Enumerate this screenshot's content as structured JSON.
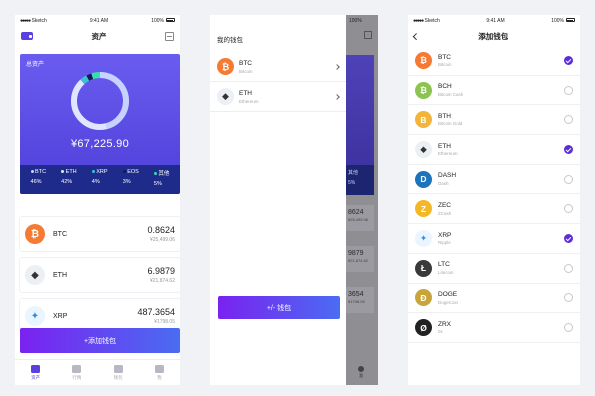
{
  "status": {
    "carrier": "Sketch",
    "time": "9:41 AM",
    "battery": "100%"
  },
  "screen1": {
    "title": "资产",
    "asset_label": "总资产",
    "total": "¥67,225.90",
    "legend": [
      {
        "name": "BTC",
        "pct": "46%",
        "color": "#c7d2ff"
      },
      {
        "name": "ETH",
        "pct": "42%",
        "color": "#e0e6ff"
      },
      {
        "name": "XRP",
        "pct": "4%",
        "color": "#3ac1d8"
      },
      {
        "name": "EOS",
        "pct": "3%",
        "color": "#141a55"
      },
      {
        "name": "其他",
        "pct": "5%",
        "color": "#2ee3a8"
      }
    ],
    "coins": [
      {
        "sym": "BTC",
        "amount": "0.8624",
        "cny": "¥25,499.06",
        "color": "#f57a33",
        "glyph": "₿"
      },
      {
        "sym": "ETH",
        "amount": "6.9879",
        "cny": "¥21,874.62",
        "color": "#eceff4",
        "glyph": "◆"
      },
      {
        "sym": "XRP",
        "amount": "487.3654",
        "cny": "¥1798.05",
        "color": "#eaf5ff",
        "glyph": "✦"
      }
    ],
    "add_button": "+添加钱包",
    "tabs": [
      {
        "label": "资产",
        "active": true,
        "icon": "wallet-icon"
      },
      {
        "label": "行情",
        "active": false,
        "icon": "chart-icon"
      },
      {
        "label": "钱包",
        "active": false,
        "icon": "briefcase-icon"
      },
      {
        "label": "我",
        "active": false,
        "icon": "user-icon"
      }
    ]
  },
  "screen2": {
    "drawer_title": "我的钱包",
    "wallets": [
      {
        "sym": "BTC",
        "name": "Bitcoin",
        "color": "#f57a33",
        "glyph": "₿"
      },
      {
        "sym": "ETH",
        "name": "Ethereum",
        "color": "#eceff4",
        "glyph": "◆"
      }
    ],
    "drawer_button": "+/- 钱包",
    "under": {
      "other_label": "其他",
      "other_pct": "5%",
      "values": [
        "8624",
        "9879",
        "3654"
      ],
      "subs": [
        "¥25,499.06",
        "¥21,874.62",
        "¥1798.05"
      ],
      "tab_label": "我"
    }
  },
  "screen3": {
    "title": "添加钱包",
    "coins": [
      {
        "sym": "BTC",
        "name": "Bitcoin",
        "color": "#f57a33",
        "glyph": "₿",
        "checked": true
      },
      {
        "sym": "BCH",
        "name": "Bitcoin Cash",
        "color": "#8dc351",
        "glyph": "₿",
        "checked": false
      },
      {
        "sym": "BTH",
        "name": "Bitcoin Gold",
        "color": "#f3b43a",
        "glyph": "B",
        "checked": false
      },
      {
        "sym": "ETH",
        "name": "Ethereum",
        "color": "#eceff4",
        "glyph": "◆",
        "checked": true
      },
      {
        "sym": "DASH",
        "name": "Dash",
        "color": "#1c75bc",
        "glyph": "D",
        "checked": false
      },
      {
        "sym": "ZEC",
        "name": "ZCash",
        "color": "#f4b728",
        "glyph": "Z",
        "checked": false
      },
      {
        "sym": "XRP",
        "name": "Ripple",
        "color": "#eaf5ff",
        "glyph": "✦",
        "checked": true
      },
      {
        "sym": "LTC",
        "name": "Litecoin",
        "color": "#3a3a3a",
        "glyph": "Ł",
        "checked": false
      },
      {
        "sym": "DOGE",
        "name": "DogeCoin",
        "color": "#c9a43a",
        "glyph": "Ð",
        "checked": false
      },
      {
        "sym": "ZRX",
        "name": "0x",
        "color": "#222222",
        "glyph": "Ø",
        "checked": false
      }
    ]
  }
}
